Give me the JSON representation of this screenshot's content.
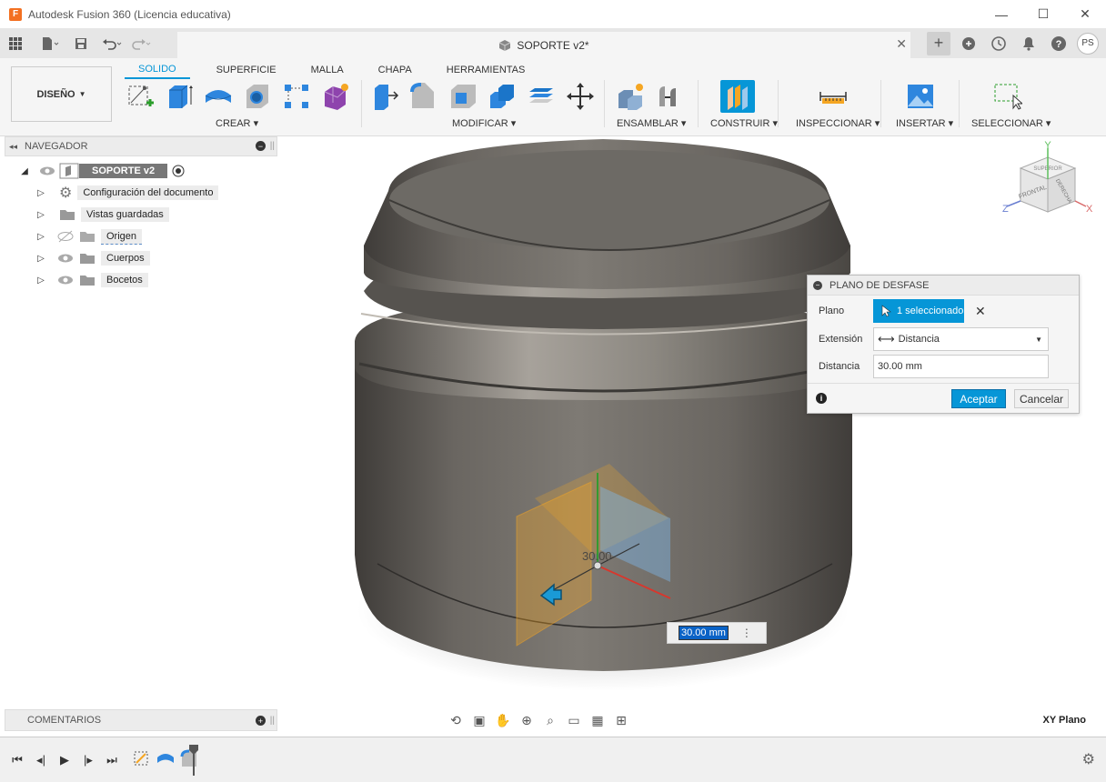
{
  "window": {
    "title": "Autodesk Fusion 360 (Licencia educativa)",
    "logo_letter": "F",
    "controls": [
      "minimize-icon",
      "maximize-icon",
      "close-icon"
    ]
  },
  "tabbar": {
    "doc_title": "SOPORTE v2*",
    "user_initials": "PS"
  },
  "ribbon": {
    "workspace": "DISEÑO",
    "tabs": [
      "SOLIDO",
      "SUPERFICIE",
      "MALLA",
      "CHAPA",
      "HERRAMIENTAS"
    ],
    "active_tab": "SOLIDO",
    "groups": {
      "crear": "CREAR",
      "modificar": "MODIFICAR",
      "ensamblar": "ENSAMBLAR",
      "construir": "CONSTRUIR",
      "inspeccionar": "INSPECCIONAR",
      "insertar": "INSERTAR",
      "seleccionar": "SELECCIONAR"
    },
    "accent": "#0696d7"
  },
  "browser": {
    "title": "NAVEGADOR",
    "root": "SOPORTE v2",
    "items": [
      {
        "label": "Configuración del documento",
        "icon": "gear-icon"
      },
      {
        "label": "Vistas guardadas",
        "icon": "folder-icon"
      },
      {
        "label": "Origen",
        "icon": "folder-icon"
      },
      {
        "label": "Cuerpos",
        "icon": "folder-icon"
      },
      {
        "label": "Bocetos",
        "icon": "folder-icon"
      }
    ]
  },
  "comments": {
    "title": "COMENTARIOS"
  },
  "viewport": {
    "dimension_label": "30.00",
    "dimension_input": "30.00 mm",
    "plane_label": "XY Plano",
    "viewcube": {
      "front": "FRONTAL",
      "right": "DERECHA",
      "top": "SUPERIOR",
      "x": "X",
      "y": "Y",
      "z": "Z"
    }
  },
  "dialog": {
    "title": "PLANO DE DESFASE",
    "plano_label": "Plano",
    "plano_value": "1 seleccionado",
    "extension_label": "Extensión",
    "extension_value": "Distancia",
    "distancia_label": "Distancia",
    "distancia_value": "30.00 mm",
    "ok": "Aceptar",
    "cancel": "Cancelar"
  }
}
